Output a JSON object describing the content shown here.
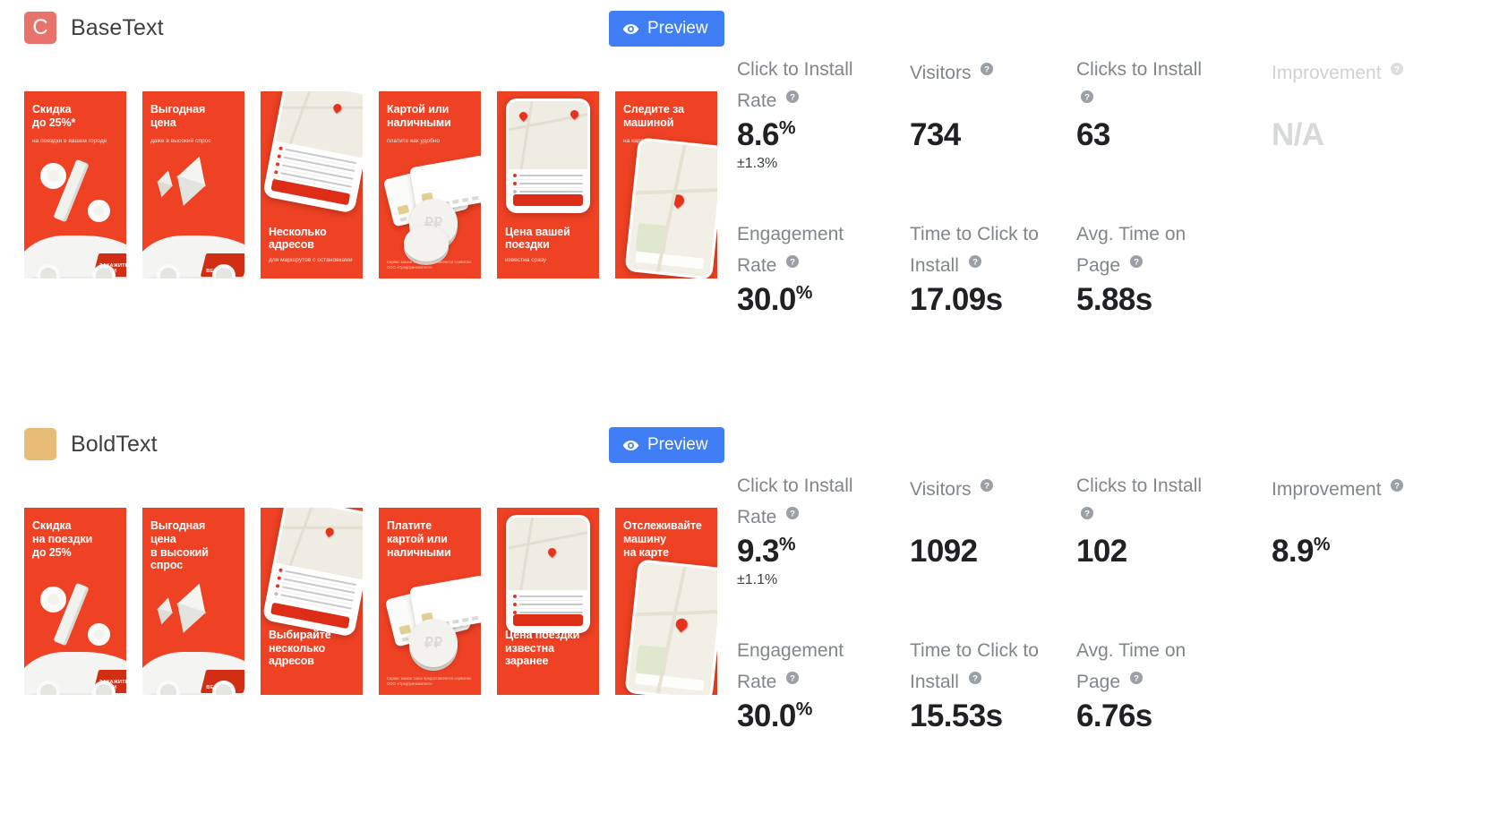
{
  "colors": {
    "preview_button": "#3f7ef4",
    "label_gray": "#80868b",
    "value_dark": "#202124",
    "faded_gray": "#d7d9db",
    "creative_red": "#ef4123"
  },
  "icons": {
    "eye": "eye-icon",
    "help": "help-circle-icon"
  },
  "variants": [
    {
      "swatch_letter": "C",
      "swatch_color": "#e8736b",
      "name": "BaseText",
      "preview_label": "Preview",
      "creatives": [
        {
          "headline": "Скидка\nдо 25%*",
          "subline": "на поездки в вашем городе"
        },
        {
          "headline": "Выгодная\nцена",
          "subline": "даже в высокий спрос"
        },
        {
          "headline": "Несколько\nадресов",
          "subline": "для маршрутов с остановками"
        },
        {
          "headline": "Картой или\nналичными",
          "subline": "платите как удобно"
        },
        {
          "headline": "Цена вашей\nпоездки",
          "subline": "известна сразу"
        },
        {
          "headline": "Следите за\nмашиной",
          "subline": "на карте"
        }
      ],
      "metrics": [
        {
          "label": "Click to Install Rate",
          "value": "8.6",
          "suffix": "%",
          "error": "±1.3%",
          "help": true,
          "faded": false
        },
        {
          "label": "Visitors",
          "value": "734",
          "suffix": "",
          "error": "",
          "help": true,
          "faded": false
        },
        {
          "label": "Clicks to Install",
          "value": "63",
          "suffix": "",
          "error": "",
          "help": true,
          "faded": false
        },
        {
          "label": "Improvement",
          "value": "N/A",
          "suffix": "",
          "error": "",
          "help": true,
          "faded": true
        },
        {
          "label": "Engagement Rate",
          "value": "30.0",
          "suffix": "%",
          "error": "",
          "help": true,
          "faded": false
        },
        {
          "label": "Time to Click to Install",
          "value": "17.09s",
          "suffix": "",
          "error": "",
          "help": true,
          "faded": false
        },
        {
          "label": "Avg. Time on Page",
          "value": "5.88s",
          "suffix": "",
          "error": "",
          "help": true,
          "faded": false
        }
      ]
    },
    {
      "swatch_letter": "",
      "swatch_color": "#e6bc77",
      "name": "BoldText",
      "preview_label": "Preview",
      "creatives": [
        {
          "headline": "Скидка\nна поездки\nдо 25%",
          "subline": ""
        },
        {
          "headline": "Выгодная\nцена\nв высокий\nспрос",
          "subline": ""
        },
        {
          "headline": "Выбирайте\nнесколько\nадресов",
          "subline": ""
        },
        {
          "headline": "Платите\nкартой или\nналичными",
          "subline": ""
        },
        {
          "headline": "Цена поездки\nизвестна\nзаранее",
          "subline": ""
        },
        {
          "headline": "Отслеживайте\nмашину\nна карте",
          "subline": ""
        }
      ],
      "metrics": [
        {
          "label": "Click to Install Rate",
          "value": "9.3",
          "suffix": "%",
          "error": "±1.1%",
          "help": true,
          "faded": false
        },
        {
          "label": "Visitors",
          "value": "1092",
          "suffix": "",
          "error": "",
          "help": true,
          "faded": false
        },
        {
          "label": "Clicks to Install",
          "value": "102",
          "suffix": "",
          "error": "",
          "help": true,
          "faded": false
        },
        {
          "label": "Improvement",
          "value": "8.9",
          "suffix": "%",
          "error": "",
          "help": true,
          "faded": false
        },
        {
          "label": "Engagement Rate",
          "value": "30.0",
          "suffix": "%",
          "error": "",
          "help": true,
          "faded": false
        },
        {
          "label": "Time to Click to Install",
          "value": "15.53s",
          "suffix": "",
          "error": "",
          "help": true,
          "faded": false
        },
        {
          "label": "Avg. Time on Page",
          "value": "6.76s",
          "suffix": "",
          "error": "",
          "help": true,
          "faded": false
        }
      ]
    }
  ]
}
